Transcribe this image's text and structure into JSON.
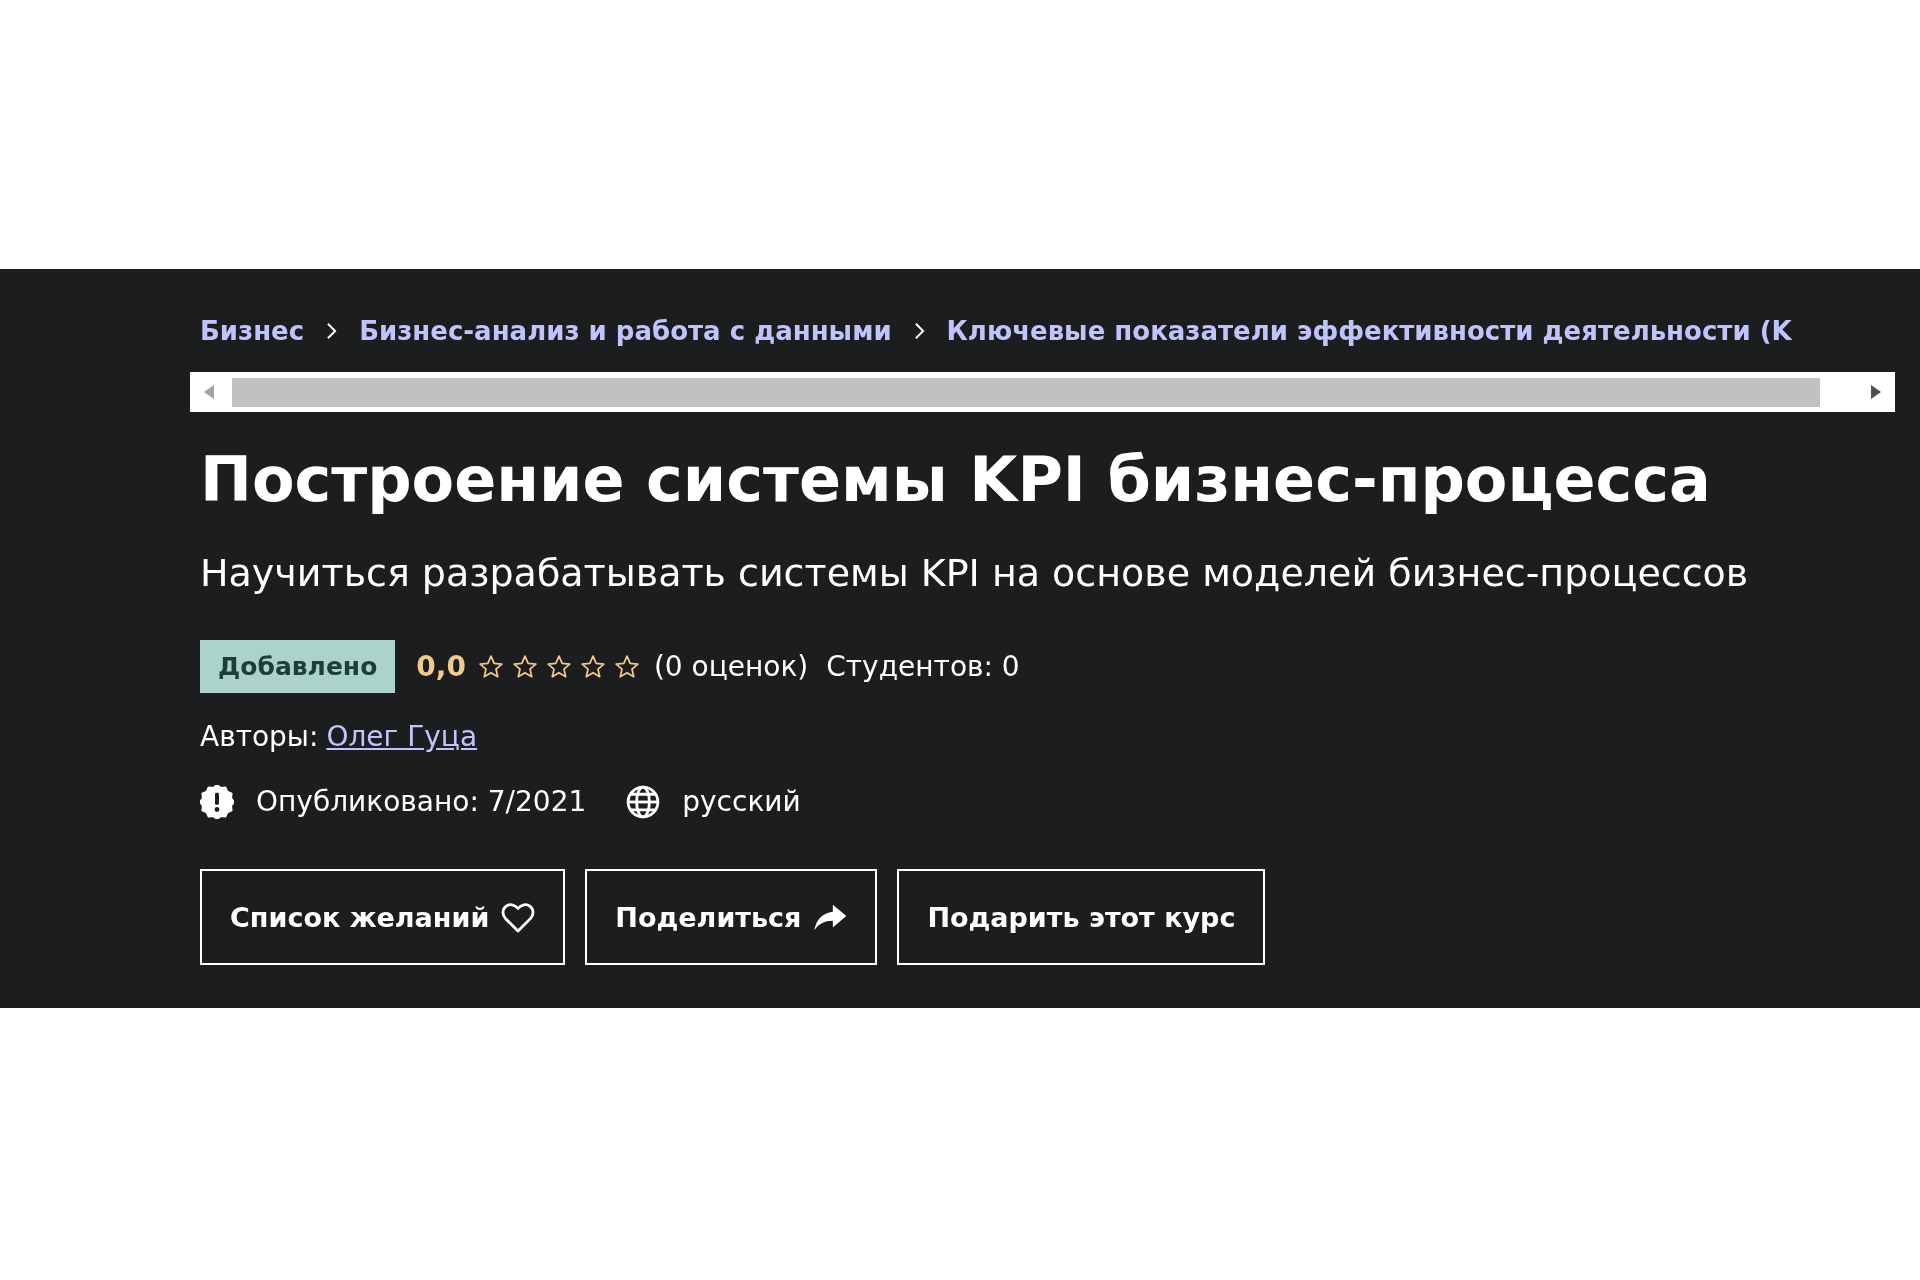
{
  "breadcrumb": {
    "items": [
      {
        "label": "Бизнес"
      },
      {
        "label": "Бизнес-анализ и работа с данными"
      },
      {
        "label": "Ключевые показатели эффективности деятельности (K"
      }
    ]
  },
  "course": {
    "title": "Построение системы KPI бизнес-процесса",
    "subtitle": "Научиться разрабатывать системы KPI на основе моделей бизнес-процессов",
    "badge": "Добавлено",
    "rating": {
      "score": "0,0",
      "stars": 0,
      "count": "(0 оценок)"
    },
    "students": "Студентов: 0",
    "authors_label": "Авторы:",
    "authors": [
      {
        "name": "Олег Гуца"
      }
    ],
    "details": [
      {
        "kind": "published",
        "text": "Опубликовано: 7/2021"
      },
      {
        "kind": "language",
        "text": "русский"
      }
    ]
  },
  "buttons": [
    {
      "kind": "wishlist",
      "label": "Список желаний"
    },
    {
      "kind": "share",
      "label": "Поделиться"
    },
    {
      "kind": "gift",
      "label": "Подарить этот курс"
    }
  ]
}
